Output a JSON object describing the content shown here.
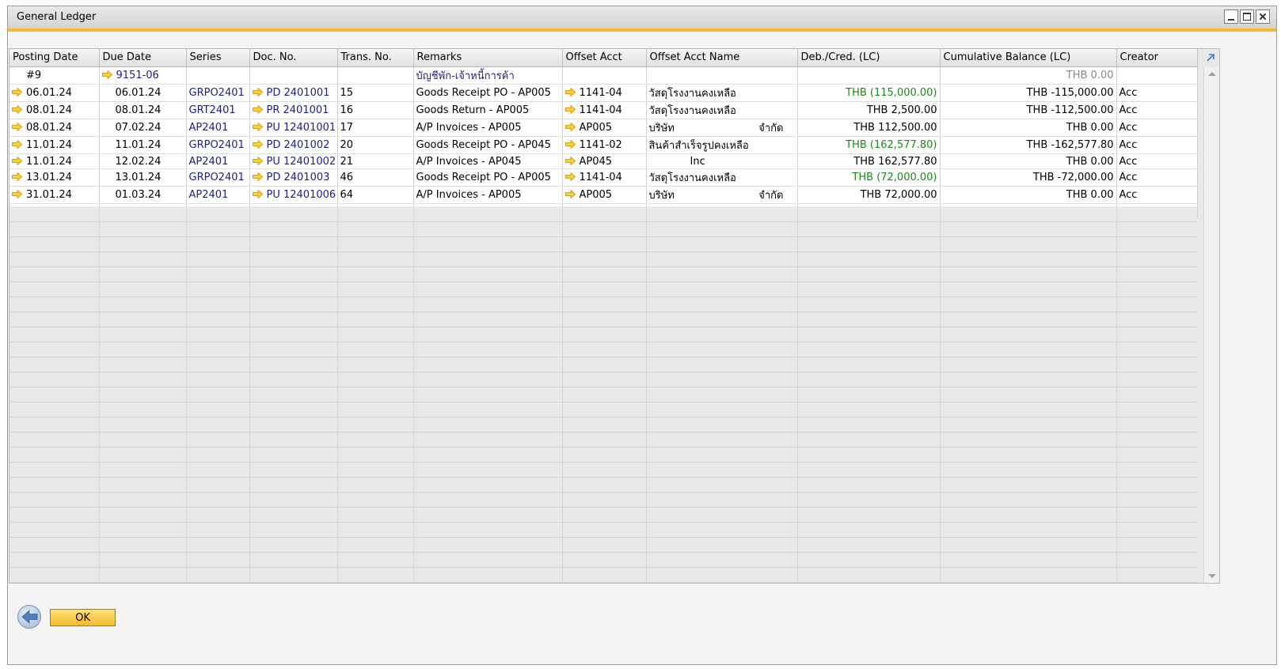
{
  "window": {
    "title": "General Ledger"
  },
  "columns": [
    "Posting Date",
    "Due Date",
    "Series",
    "Doc. No.",
    "Trans. No.",
    "Remarks",
    "Offset Acct",
    "Offset Acct Name",
    "Deb./Cred. (LC)",
    "Cumulative Balance (LC)",
    "Creator"
  ],
  "rows": [
    {
      "posting_date": "#9",
      "due_date": "9151-06",
      "series": "",
      "doc_no": "",
      "trans_no": "",
      "remarks": "บัญชีพัก-เจ้าหนี้การค้า",
      "offset_acct": "",
      "offset_name": "",
      "debcred": "",
      "cumulative": "THB 0.00",
      "creator": ""
    },
    {
      "posting_date": "06.01.24",
      "due_date": "06.01.24",
      "series": "GRPO2401",
      "doc_no": "PD 2401001",
      "trans_no": "15",
      "remarks": "Goods Receipt PO - AP005",
      "offset_acct": "1141-04",
      "offset_name": "วัสดุโรงงานคงเหลือ",
      "debcred": "THB (115,000.00)",
      "cumulative": "THB -115,000.00",
      "creator": "Acc"
    },
    {
      "posting_date": "08.01.24",
      "due_date": "08.01.24",
      "series": "GRT2401",
      "doc_no": "PR 2401001",
      "trans_no": "16",
      "remarks": "Goods Return - AP005",
      "offset_acct": "1141-04",
      "offset_name": "วัสดุโรงงานคงเหลือ",
      "debcred": "THB 2,500.00",
      "cumulative": "THB -112,500.00",
      "creator": "Acc"
    },
    {
      "posting_date": "08.01.24",
      "due_date": "07.02.24",
      "series": "AP2401",
      "doc_no": "PU 12401001",
      "trans_no": "17",
      "remarks": "A/P Invoices - AP005",
      "offset_acct": "AP005",
      "offset_name": "บริษัท",
      "offset_suffix": "จำกัด",
      "debcred": "THB 112,500.00",
      "cumulative": "THB 0.00",
      "creator": "Acc"
    },
    {
      "posting_date": "11.01.24",
      "due_date": "11.01.24",
      "series": "GRPO2401",
      "doc_no": "PD 2401002",
      "trans_no": "20",
      "remarks": "Goods Receipt PO - AP045",
      "offset_acct": "1141-02",
      "offset_name": "สินค้าสำเร็จรูปคงเหลือ",
      "debcred": "THB (162,577.80)",
      "cumulative": "THB -162,577.80",
      "creator": "Acc"
    },
    {
      "posting_date": "11.01.24",
      "due_date": "12.02.24",
      "series": "AP2401",
      "doc_no": "PU 12401002",
      "trans_no": "21",
      "remarks": "A/P Invoices - AP045",
      "offset_acct": "AP045",
      "offset_name": "Inc",
      "debcred": "THB 162,577.80",
      "cumulative": "THB 0.00",
      "creator": "Acc"
    },
    {
      "posting_date": "13.01.24",
      "due_date": "13.01.24",
      "series": "GRPO2401",
      "doc_no": "PD 2401003",
      "trans_no": "46",
      "remarks": "Goods Receipt PO - AP005",
      "offset_acct": "1141-04",
      "offset_name": "วัสดุโรงงานคงเหลือ",
      "debcred": "THB (72,000.00)",
      "cumulative": "THB -72,000.00",
      "creator": "Acc"
    },
    {
      "posting_date": "31.01.24",
      "due_date": "01.03.24",
      "series": "AP2401",
      "doc_no": "PU 12401006",
      "trans_no": "64",
      "remarks": "A/P Invoices - AP005",
      "offset_acct": "AP005",
      "offset_name": "บริษัท",
      "offset_suffix": "จำกัด",
      "debcred": "THB 72,000.00",
      "cumulative": "THB 0.00",
      "creator": "Acc"
    }
  ],
  "footer": {
    "ok_label": "OK"
  },
  "icons": {
    "link_arrow": "link-arrow-icon",
    "back": "back-arrow-icon",
    "expand": "expand-columns-icon"
  },
  "colors": {
    "accent": "#f5b833",
    "link": "#1d1d8a",
    "credit_green": "#1a8a1a",
    "highlight": "#e3121d",
    "ok_button": "#f4b92b",
    "link_arrow": "#f5c400"
  }
}
